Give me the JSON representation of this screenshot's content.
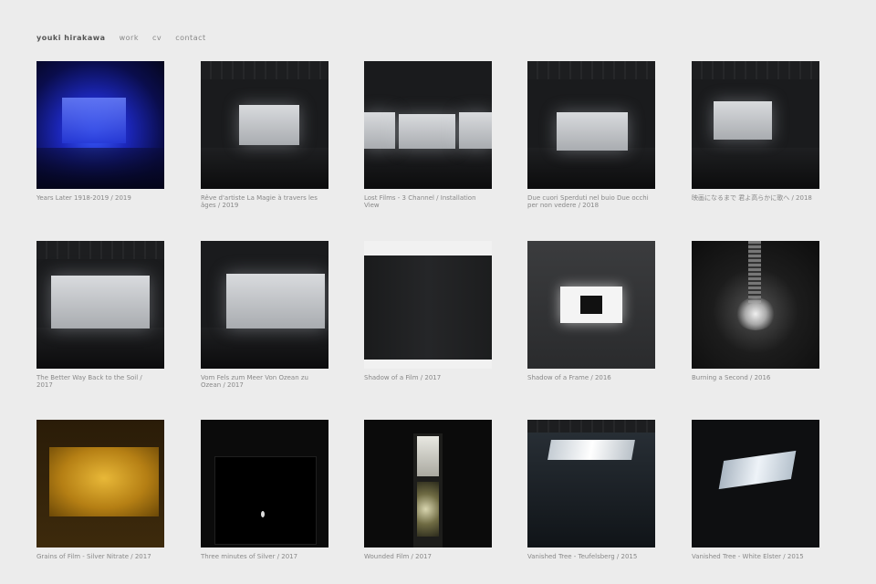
{
  "nav": {
    "brand": "youki hirakawa",
    "links": [
      "work",
      "cv",
      "contact"
    ]
  },
  "works": [
    {
      "caption": "Years Later 1918-2019 / 2019",
      "thumb": "blue-installation"
    },
    {
      "caption": "Rêve d'artiste La Magie à travers les âges / 2019",
      "thumb": "dark-room-screen"
    },
    {
      "caption": "Lost Films - 3 Channel / Installation View",
      "thumb": "three-screens"
    },
    {
      "caption": "Due cuori Sperduti nel buio Due occhi per non vedere / 2018",
      "thumb": "dark-room-screen"
    },
    {
      "caption": "映画になるまで 君よ高らかに歌へ / 2018",
      "thumb": "dark-room-screen"
    },
    {
      "caption": "The Better Way Back to the Soil / 2017",
      "thumb": "dark-room-screen"
    },
    {
      "caption": "Vom Fels zum Meer Von Ozean zu Ozean / 2017",
      "thumb": "dark-room-screen"
    },
    {
      "caption": "Shadow of a Film / 2017",
      "thumb": "black-panel"
    },
    {
      "caption": "Shadow of a Frame / 2016",
      "thumb": "white-frame"
    },
    {
      "caption": "Burning a Second / 2016",
      "thumb": "burning-film"
    },
    {
      "caption": "Grains of Film - Silver Nitrate / 2017",
      "thumb": "gold-screen"
    },
    {
      "caption": "Three minutes of Silver / 2017",
      "thumb": "black-screen"
    },
    {
      "caption": "Wounded Film / 2017",
      "thumb": "film-strip"
    },
    {
      "caption": "Vanished Tree - Teufelsberg / 2015",
      "thumb": "skylight-room"
    },
    {
      "caption": "Vanished Tree - White Elster / 2015",
      "thumb": "skylight-dark"
    }
  ]
}
